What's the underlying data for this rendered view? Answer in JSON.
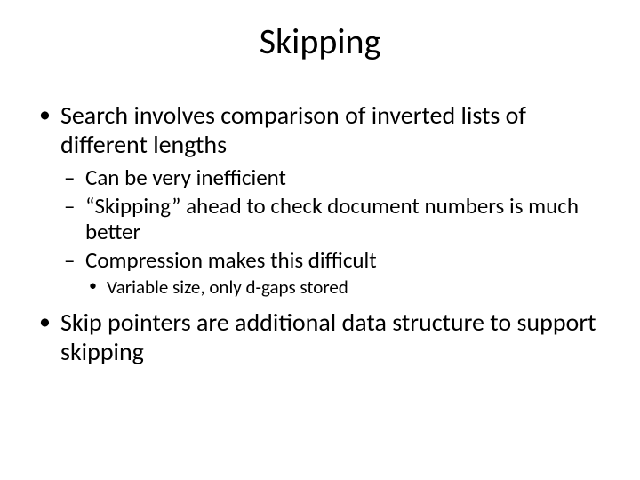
{
  "title": "Skipping",
  "bullets": [
    {
      "text": "Search involves comparison of inverted lists of different lengths",
      "children": [
        {
          "text": "Can be very inefficient"
        },
        {
          "text": "“Skipping” ahead to check document numbers is much better"
        },
        {
          "text": "Compression makes this difficult",
          "children": [
            {
              "text": "Variable size, only d-gaps stored"
            }
          ]
        }
      ]
    },
    {
      "text": "Skip pointers are additional data structure to support skipping"
    }
  ]
}
